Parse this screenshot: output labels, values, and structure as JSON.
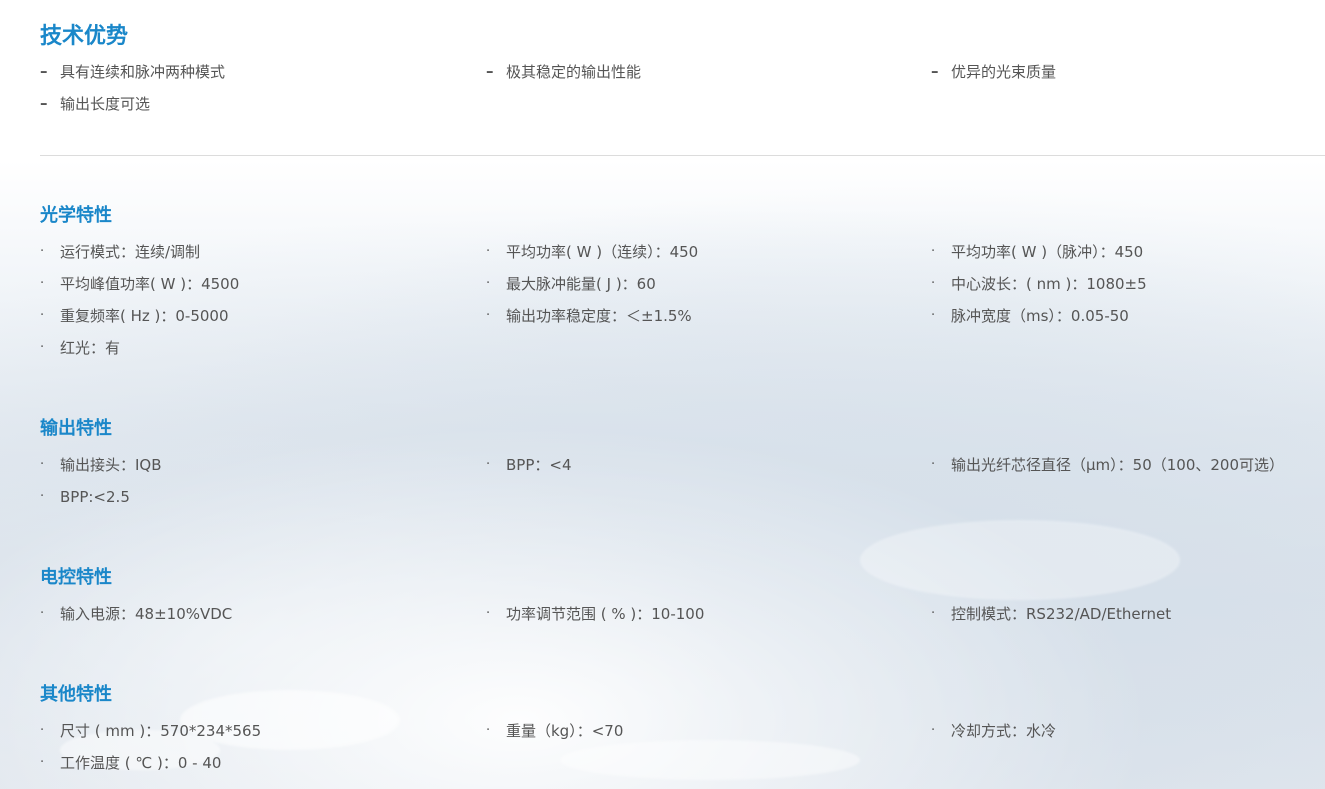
{
  "sections": {
    "advantages": {
      "title": "技术优势",
      "items": [
        "具有连续和脉冲两种模式",
        "极其稳定的输出性能",
        "优异的光束质量",
        "输出长度可选"
      ]
    },
    "optical": {
      "title": "光学特性",
      "items": [
        "运行模式：连续/调制",
        "平均功率( W )（连续）：450",
        "平均功率( W )（脉冲）：450",
        "平均峰值功率( W )：4500",
        "最大脉冲能量( J )：60",
        "中心波长：( nm )：1080±5",
        "重复频率( Hz )：0-5000",
        "输出功率稳定度：＜±1.5%",
        "脉冲宽度（ms）：0.05-50",
        "红光：有"
      ]
    },
    "output": {
      "title": "输出特性",
      "items": [
        "输出接头：IQB",
        "BPP：<4",
        "输出光纤芯径直径（μm）：50（100、200可选）",
        "BPP:<2.5"
      ]
    },
    "electrical": {
      "title": "电控特性",
      "items": [
        "输入电源：48±10%VDC",
        "功率调节范围 ( % )：10-100",
        "控制模式：RS232/AD/Ethernet"
      ]
    },
    "other": {
      "title": "其他特性",
      "items": [
        "尺寸 ( mm )：570*234*565",
        "重量（kg）：<70",
        "冷却方式：水冷",
        "工作温度 ( ℃ )：0 - 40"
      ]
    }
  },
  "markers": {
    "dash": "–",
    "dot": "·"
  }
}
